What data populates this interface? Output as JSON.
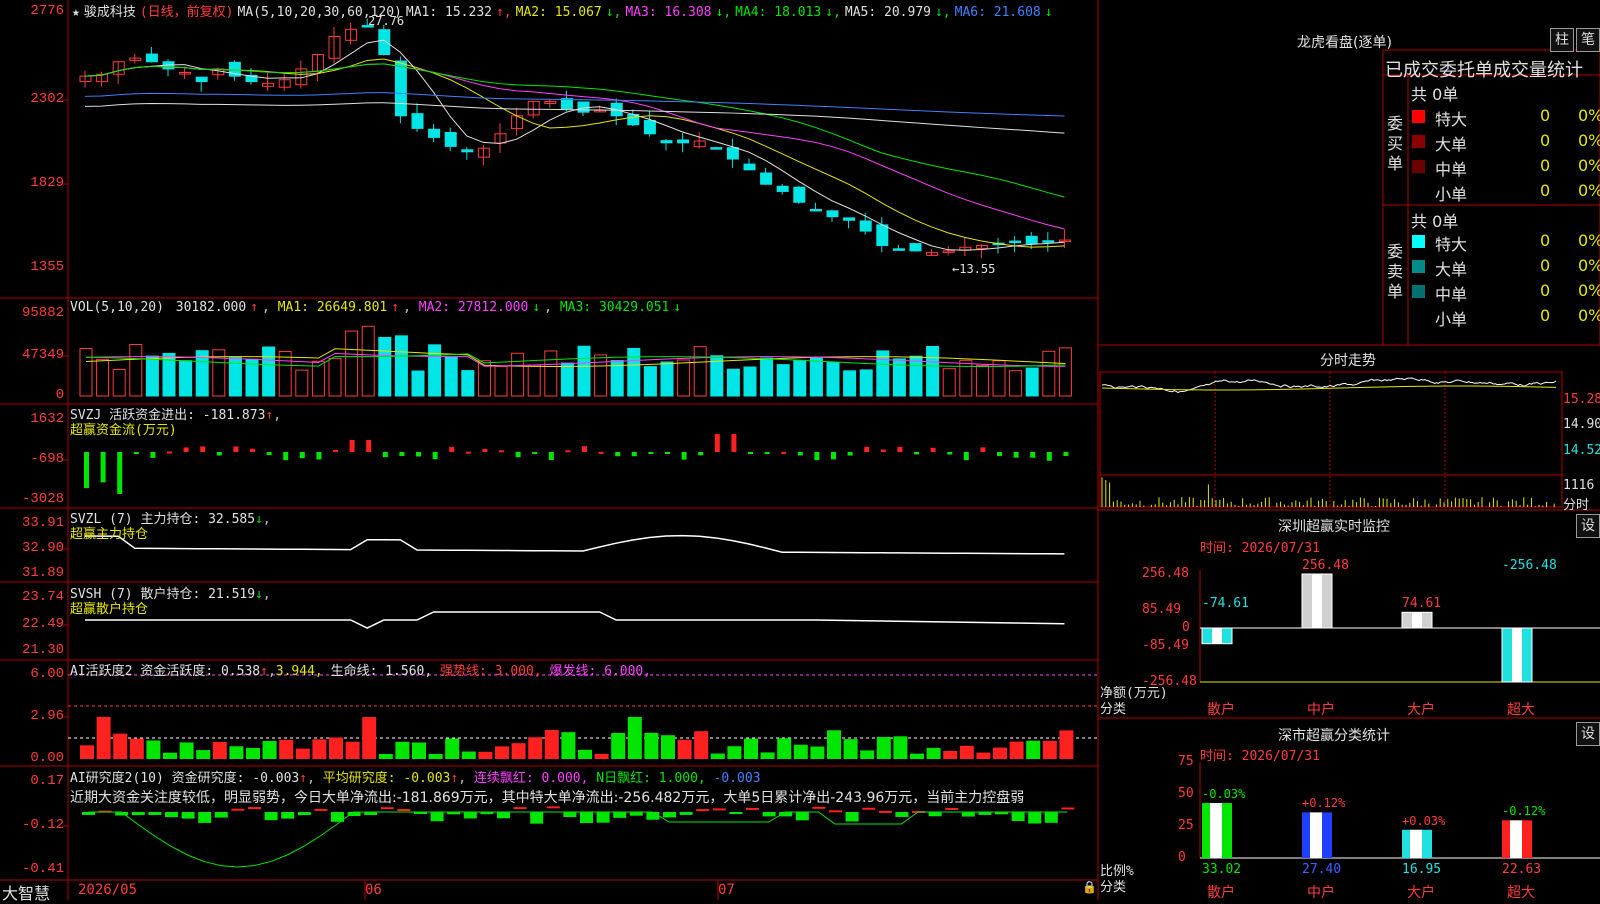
{
  "window": {
    "app_name": "大智慧"
  },
  "price_panel": {
    "star": "★",
    "stock_name": "骏成科技",
    "mode": "(日线，前复权)",
    "ma_params": "MA(5,10,20,30,60,120)",
    "legend": [
      {
        "label": "MA1: 15.232",
        "arrow": "↑",
        "color": "#e0e0e0"
      },
      {
        "label": "MA2: 15.067",
        "arrow": "↓",
        "color": "#e6e600"
      },
      {
        "label": "MA3: 16.308",
        "arrow": "↓",
        "color": "#ff40ff"
      },
      {
        "label": "MA4: 18.013",
        "arrow": "↓",
        "color": "#00e600"
      },
      {
        "label": "MA5: 20.979",
        "arrow": "↓",
        "color": "#e0e0e0"
      },
      {
        "label": "MA6: 21.608",
        "arrow": "↓",
        "color": "#4080ff"
      }
    ],
    "high_label": "27.76",
    "low_label": "←13.55",
    "y_ticks": [
      "2776",
      "2302",
      "1829",
      "1355"
    ]
  },
  "vol_panel": {
    "title": "VOL(5,10,20)",
    "value": "30182.000",
    "ma1": "MA1: 26649.801",
    "ma2": "MA2: 27812.000",
    "ma3": "MA3: 30429.051",
    "y_ticks": [
      "95882",
      "47349",
      "0"
    ]
  },
  "svzj_panel": {
    "title": "SVZJ",
    "line": "活跃资金进出: -181.873",
    "sub": "超赢资金流(万元)",
    "y_ticks": [
      "1632",
      "-698",
      "-3028"
    ]
  },
  "svzl_panel": {
    "title": "SVZL (7)",
    "line": "主力持仓: 32.585",
    "sub": "超赢主力持仓",
    "y_ticks": [
      "33.91",
      "32.90",
      "31.89"
    ]
  },
  "svsh_panel": {
    "title": "SVSH (7)",
    "line": "散户持仓: 21.519",
    "sub": "超赢散户持仓",
    "y_ticks": [
      "23.74",
      "22.49",
      "21.30"
    ]
  },
  "ai_active_panel": {
    "title": "AI活跃度2",
    "line1": "资金活跃度: 0.538",
    "line2": "3.944,",
    "life": "生命线: 1.560,",
    "strong": "强势线: 3.000,",
    "burst": "爆发线: 6.000,",
    "y_ticks": [
      "6.00",
      "2.96",
      "0.00"
    ]
  },
  "ai_research_panel": {
    "title": "AI研究度2(10)",
    "r1": "资金研究度: -0.003",
    "r2": "平均研究度: -0.003",
    "r3": "连续飘红: 0.000,",
    "r4": "N日飘红: 1.000,",
    "r5": "-0.003",
    "commentary": "近期大资金关注度较低，明显弱势，今日大单净流出:-181.869万元，其中特大单净流出:-256.482万元，大单5日累计净出-243.96万元，当前主力控盘弱",
    "y_ticks": [
      "0.17",
      "-0.12",
      "-0.41"
    ]
  },
  "x_axis": {
    "labels": [
      "2026/05",
      "06",
      "07"
    ]
  },
  "longhu": {
    "title": "龙虎看盘(逐单)",
    "btn_zhu": "柱",
    "btn_bi": "笔",
    "tabs_text": "已成交委托单成交量统计",
    "buy_label": "委买单",
    "sell_label": "委卖单",
    "buy_total": "共 0单",
    "sell_total": "共 0单",
    "buy_rows": [
      {
        "name": "特大",
        "count": "0",
        "pct": "0%",
        "color": "#ff0000"
      },
      {
        "name": "大单",
        "count": "0",
        "pct": "0%",
        "color": "#8b0000"
      },
      {
        "name": "中单",
        "count": "0",
        "pct": "0%",
        "color": "#6b0000"
      },
      {
        "name": "小单",
        "count": "0",
        "pct": "0%",
        "color": ""
      }
    ],
    "sell_rows": [
      {
        "name": "特大",
        "count": "0",
        "pct": "0%",
        "color": "#00ffff"
      },
      {
        "name": "大单",
        "count": "0",
        "pct": "0%",
        "color": "#008b8b"
      },
      {
        "name": "中单",
        "count": "0",
        "pct": "0%",
        "color": "#007070"
      },
      {
        "name": "小单",
        "count": "0",
        "pct": "0%",
        "color": ""
      }
    ]
  },
  "intraday": {
    "title": "分时走势",
    "price_ticks": [
      "15.28",
      "14.90",
      "14.52"
    ],
    "vol_tick": "1116",
    "vol_unit": "分时"
  },
  "monitor": {
    "title": "深圳超赢实时监控",
    "btn": "设",
    "time": "时间: 2026/07/31",
    "y_ticks": [
      "256.48",
      "85.49",
      "0",
      "-85.49",
      "-256.48"
    ],
    "ylabel": "净额(万元)",
    "xlabel": "分类"
  },
  "classify": {
    "title": "深市超赢分类统计",
    "btn": "设",
    "time": "时间: 2026/07/31",
    "y_ticks": [
      "75",
      "50",
      "25",
      "0"
    ],
    "ylabel": "比例%",
    "xlabel": "分类"
  },
  "chart_data": [
    {
      "type": "bar",
      "title": "深圳超赢实时监控",
      "categories": [
        "散户",
        "中户",
        "大户",
        "超大"
      ],
      "values": [
        -74.61,
        256.48,
        74.61,
        -256.48
      ],
      "labels": [
        "-74.61",
        "256.48",
        "74.61",
        "-256.48"
      ],
      "ylim": [
        -256.48,
        256.48
      ]
    },
    {
      "type": "bar",
      "title": "深市超赢分类统计",
      "categories": [
        "散户",
        "中户",
        "大户",
        "超大"
      ],
      "values": [
        33.02,
        27.4,
        16.95,
        22.63
      ],
      "labels": [
        "33.02",
        "27.40",
        "16.95",
        "22.63"
      ],
      "change_labels": [
        "-0.03%",
        "+0.12%",
        "+0.03%",
        "-0.12%"
      ],
      "ylim": [
        0,
        75
      ]
    }
  ],
  "colors": {
    "up": "#ff3b3b",
    "down": "#00e6e6",
    "grid": "#b00000"
  }
}
